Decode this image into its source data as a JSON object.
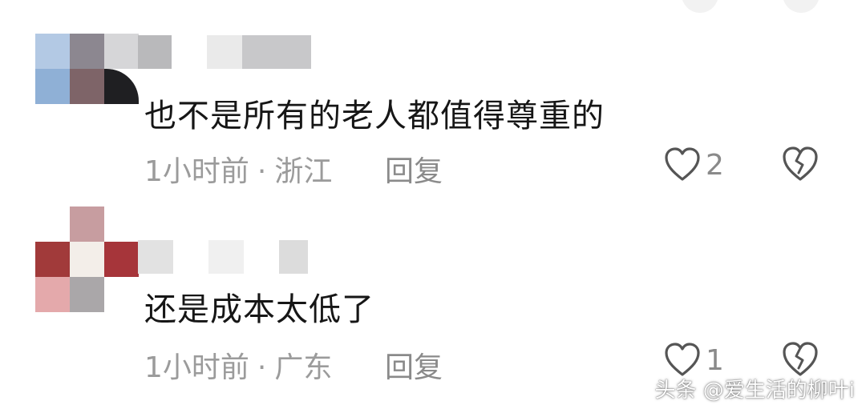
{
  "comments": [
    {
      "text": "也不是所有的老人都值得尊重的",
      "time": "1小时前",
      "separator": "·",
      "location": "浙江",
      "reply_label": "回复",
      "like_count": "2"
    },
    {
      "text": "还是成本太低了",
      "time": "1小时前",
      "separator": "·",
      "location": "广东",
      "reply_label": "回复",
      "like_count": "1"
    }
  ],
  "watermark": "头条 @爱生活的柳叶i",
  "icons": {
    "like": "heart-outline-icon",
    "dislike": "broken-heart-icon"
  },
  "colors": {
    "meta_text": "#9b9b9b",
    "icon_stroke": "#555555"
  }
}
